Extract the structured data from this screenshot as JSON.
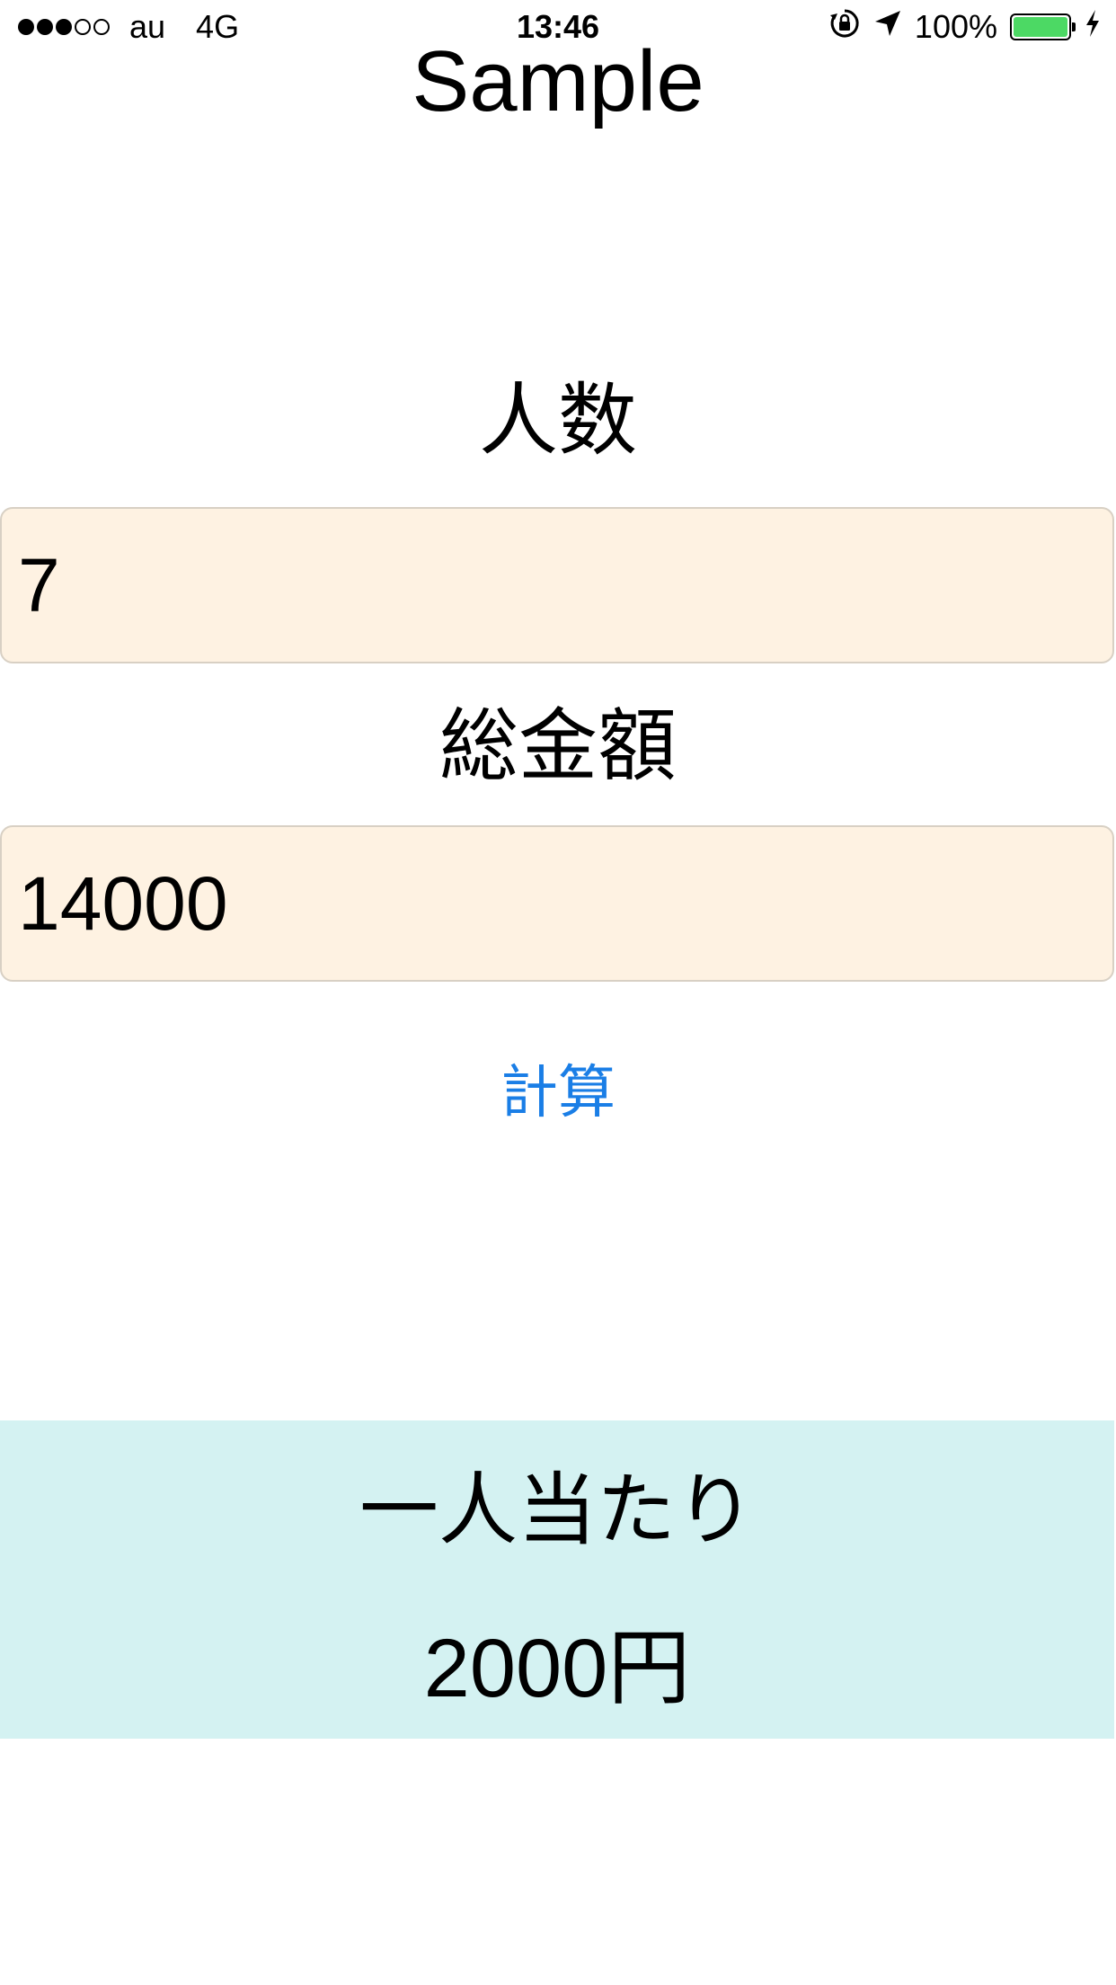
{
  "status_bar": {
    "carrier": "au",
    "network": "4G",
    "time": "13:46",
    "battery_percent": "100%",
    "battery_color": "#4cd964",
    "icons": [
      "orientation-lock-icon",
      "location-arrow-icon",
      "battery-icon",
      "charging-bolt-icon"
    ]
  },
  "header": {
    "title": "Sample"
  },
  "form": {
    "people_label": "人数",
    "people_value": "7",
    "total_label": "総金額",
    "total_value": "14000",
    "field_background": "#fef2e2"
  },
  "calculate_button": {
    "label": "計算",
    "color": "#1a7ee6"
  },
  "result": {
    "label": "一人当たり",
    "value": "2000円",
    "background": "#d4f2f2"
  }
}
